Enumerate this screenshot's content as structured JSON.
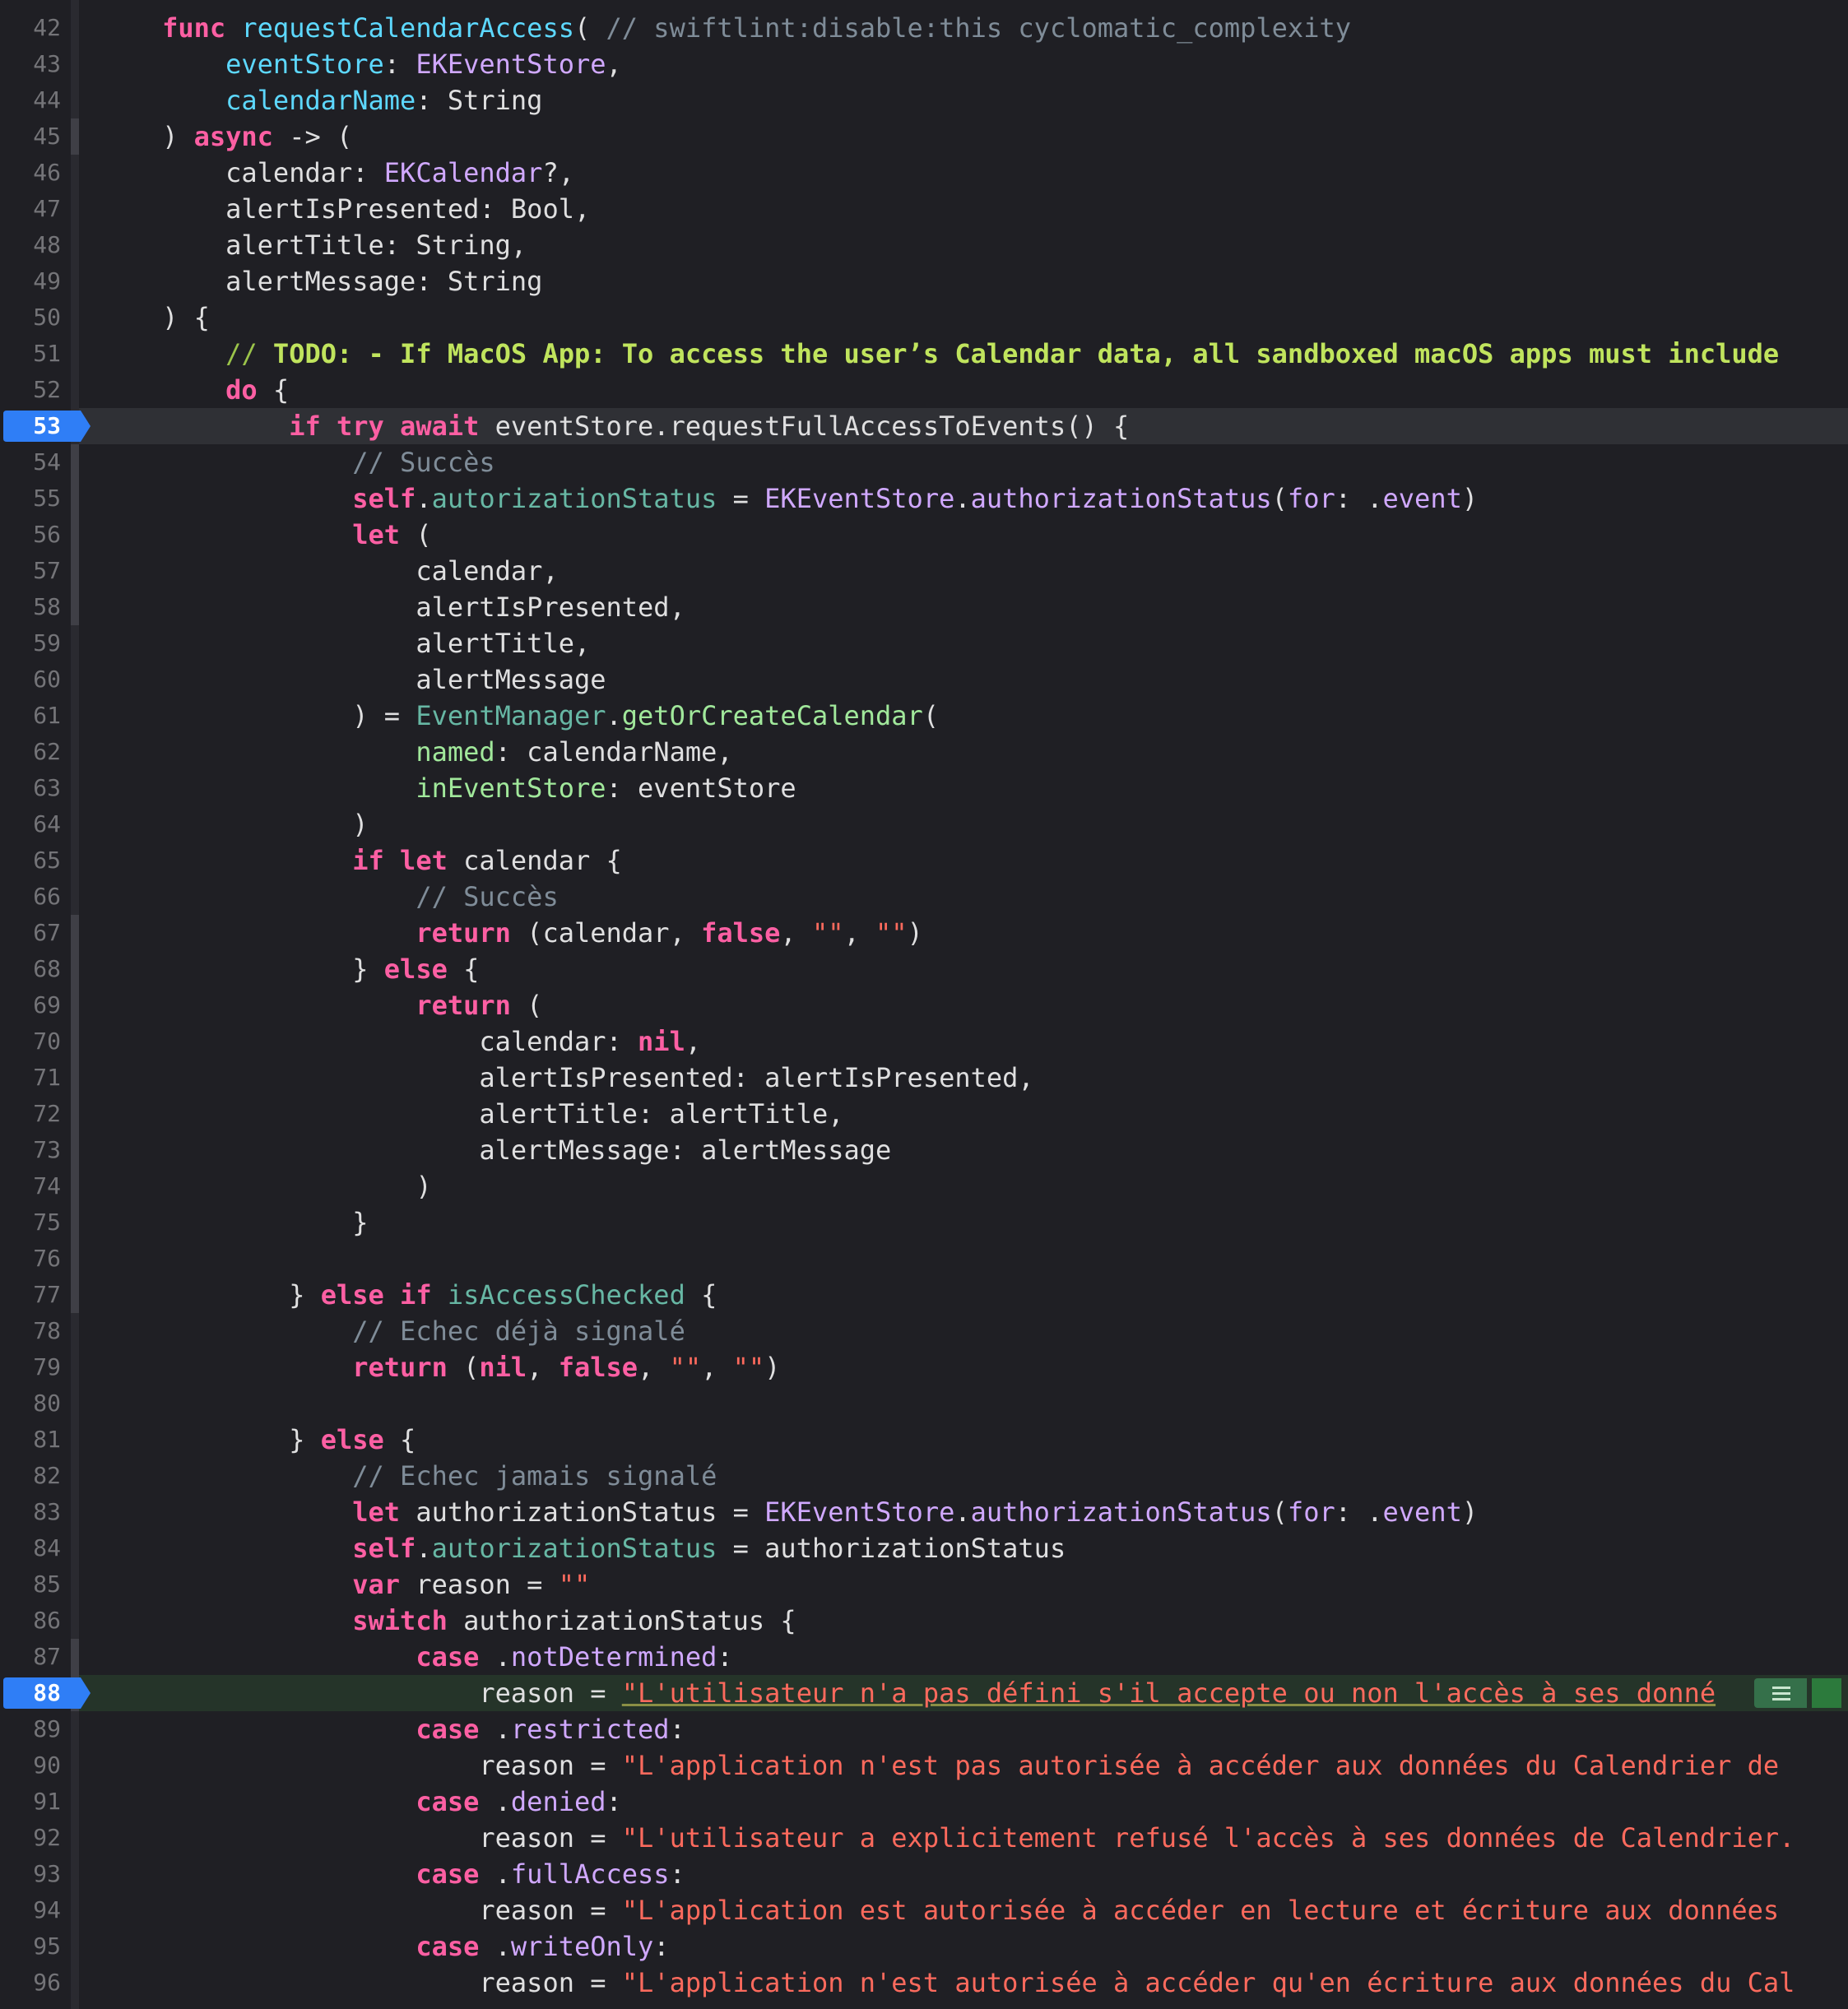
{
  "editor": {
    "language": "swift",
    "theme_colors": {
      "background": "#1f1f24",
      "keyword": "#fc5fa3",
      "declaration": "#5dd8ff",
      "type": "#d0a8ff",
      "project_symbol": "#67b7a4",
      "project_function": "#a1e89b",
      "comment": "#7f8c98",
      "string": "#fc6a5d",
      "breakpoint": "#2f7ef6"
    },
    "breakpoints": [
      53,
      88
    ],
    "current_line": 53,
    "issue_line": 88,
    "lines": [
      {
        "no": "42",
        "tokens": [
          {
            "t": "    ",
            "c": "plain"
          },
          {
            "t": "func",
            "c": "kw"
          },
          {
            "t": " ",
            "c": "plain"
          },
          {
            "t": "requestCalendarAccess",
            "c": "decl"
          },
          {
            "t": "( ",
            "c": "plain"
          },
          {
            "t": "// swiftlint:disable:this cyclomatic_complexity",
            "c": "cmt"
          }
        ]
      },
      {
        "no": "43",
        "tokens": [
          {
            "t": "        ",
            "c": "plain"
          },
          {
            "t": "eventStore",
            "c": "decl"
          },
          {
            "t": ": ",
            "c": "plain"
          },
          {
            "t": "EKEventStore",
            "c": "type"
          },
          {
            "t": ",",
            "c": "plain"
          }
        ]
      },
      {
        "no": "44",
        "tokens": [
          {
            "t": "        ",
            "c": "plain"
          },
          {
            "t": "calendarName",
            "c": "decl"
          },
          {
            "t": ": String",
            "c": "plain"
          }
        ]
      },
      {
        "no": "45",
        "tokens": [
          {
            "t": "    ) ",
            "c": "plain"
          },
          {
            "t": "async",
            "c": "kw"
          },
          {
            "t": " -> (",
            "c": "plain"
          }
        ]
      },
      {
        "no": "46",
        "tokens": [
          {
            "t": "        calendar: ",
            "c": "plain"
          },
          {
            "t": "EKCalendar",
            "c": "type"
          },
          {
            "t": "?,",
            "c": "plain"
          }
        ]
      },
      {
        "no": "47",
        "tokens": [
          {
            "t": "        alertIsPresented: Bool,",
            "c": "plain"
          }
        ]
      },
      {
        "no": "48",
        "tokens": [
          {
            "t": "        alertTitle: String,",
            "c": "plain"
          }
        ]
      },
      {
        "no": "49",
        "tokens": [
          {
            "t": "        alertMessage: String",
            "c": "plain"
          }
        ]
      },
      {
        "no": "50",
        "tokens": [
          {
            "t": "    ) {",
            "c": "plain"
          }
        ]
      },
      {
        "no": "51",
        "tokens": [
          {
            "t": "        ",
            "c": "plain"
          },
          {
            "t": "// ",
            "c": "todocm"
          },
          {
            "t": "TODO: - If MacOS App: To access the user’s Calendar data, all sandboxed macOS apps must include",
            "c": "todo"
          }
        ]
      },
      {
        "no": "52",
        "tokens": [
          {
            "t": "        ",
            "c": "plain"
          },
          {
            "t": "do",
            "c": "kw"
          },
          {
            "t": " {",
            "c": "plain"
          }
        ]
      },
      {
        "no": "53",
        "tokens": [
          {
            "t": "            ",
            "c": "plain"
          },
          {
            "t": "if try await",
            "c": "kw"
          },
          {
            "t": " eventStore.requestFullAccessToEvents() {",
            "c": "plain"
          }
        ]
      },
      {
        "no": "54",
        "tokens": [
          {
            "t": "                ",
            "c": "plain"
          },
          {
            "t": "// Succès",
            "c": "cmt"
          }
        ]
      },
      {
        "no": "55",
        "tokens": [
          {
            "t": "                ",
            "c": "plain"
          },
          {
            "t": "self",
            "c": "kw"
          },
          {
            "t": ".",
            "c": "plain"
          },
          {
            "t": "autorizationStatus",
            "c": "proj"
          },
          {
            "t": " = ",
            "c": "plain"
          },
          {
            "t": "EKEventStore",
            "c": "type"
          },
          {
            "t": ".",
            "c": "plain"
          },
          {
            "t": "authorizationStatus",
            "c": "type"
          },
          {
            "t": "(",
            "c": "plain"
          },
          {
            "t": "for",
            "c": "type"
          },
          {
            "t": ": .",
            "c": "plain"
          },
          {
            "t": "event",
            "c": "type"
          },
          {
            "t": ")",
            "c": "plain"
          }
        ]
      },
      {
        "no": "56",
        "tokens": [
          {
            "t": "                ",
            "c": "plain"
          },
          {
            "t": "let",
            "c": "kw"
          },
          {
            "t": " (",
            "c": "plain"
          }
        ]
      },
      {
        "no": "57",
        "tokens": [
          {
            "t": "                    calendar,",
            "c": "plain"
          }
        ]
      },
      {
        "no": "58",
        "tokens": [
          {
            "t": "                    alertIsPresented,",
            "c": "plain"
          }
        ]
      },
      {
        "no": "59",
        "tokens": [
          {
            "t": "                    alertTitle,",
            "c": "plain"
          }
        ]
      },
      {
        "no": "60",
        "tokens": [
          {
            "t": "                    alertMessage",
            "c": "plain"
          }
        ]
      },
      {
        "no": "61",
        "tokens": [
          {
            "t": "                ) = ",
            "c": "plain"
          },
          {
            "t": "EventManager",
            "c": "proj"
          },
          {
            "t": ".",
            "c": "plain"
          },
          {
            "t": "getOrCreateCalendar",
            "c": "projfn"
          },
          {
            "t": "(",
            "c": "plain"
          }
        ]
      },
      {
        "no": "62",
        "tokens": [
          {
            "t": "                    ",
            "c": "plain"
          },
          {
            "t": "named",
            "c": "projfn"
          },
          {
            "t": ": calendarName,",
            "c": "plain"
          }
        ]
      },
      {
        "no": "63",
        "tokens": [
          {
            "t": "                    ",
            "c": "plain"
          },
          {
            "t": "inEventStore",
            "c": "projfn"
          },
          {
            "t": ": eventStore",
            "c": "plain"
          }
        ]
      },
      {
        "no": "64",
        "tokens": [
          {
            "t": "                )",
            "c": "plain"
          }
        ]
      },
      {
        "no": "65",
        "tokens": [
          {
            "t": "                ",
            "c": "plain"
          },
          {
            "t": "if let",
            "c": "kw"
          },
          {
            "t": " calendar {",
            "c": "plain"
          }
        ]
      },
      {
        "no": "66",
        "tokens": [
          {
            "t": "                    ",
            "c": "plain"
          },
          {
            "t": "// Succès",
            "c": "cmt"
          }
        ]
      },
      {
        "no": "67",
        "tokens": [
          {
            "t": "                    ",
            "c": "plain"
          },
          {
            "t": "return",
            "c": "kw"
          },
          {
            "t": " (calendar, ",
            "c": "plain"
          },
          {
            "t": "false",
            "c": "kw"
          },
          {
            "t": ", ",
            "c": "plain"
          },
          {
            "t": "\"\"",
            "c": "str"
          },
          {
            "t": ", ",
            "c": "plain"
          },
          {
            "t": "\"\"",
            "c": "str"
          },
          {
            "t": ")",
            "c": "plain"
          }
        ]
      },
      {
        "no": "68",
        "tokens": [
          {
            "t": "                } ",
            "c": "plain"
          },
          {
            "t": "else",
            "c": "kw"
          },
          {
            "t": " {",
            "c": "plain"
          }
        ]
      },
      {
        "no": "69",
        "tokens": [
          {
            "t": "                    ",
            "c": "plain"
          },
          {
            "t": "return",
            "c": "kw"
          },
          {
            "t": " (",
            "c": "plain"
          }
        ]
      },
      {
        "no": "70",
        "tokens": [
          {
            "t": "                        calendar: ",
            "c": "plain"
          },
          {
            "t": "nil",
            "c": "kw"
          },
          {
            "t": ",",
            "c": "plain"
          }
        ]
      },
      {
        "no": "71",
        "tokens": [
          {
            "t": "                        alertIsPresented: alertIsPresented,",
            "c": "plain"
          }
        ]
      },
      {
        "no": "72",
        "tokens": [
          {
            "t": "                        alertTitle: alertTitle,",
            "c": "plain"
          }
        ]
      },
      {
        "no": "73",
        "tokens": [
          {
            "t": "                        alertMessage: alertMessage",
            "c": "plain"
          }
        ]
      },
      {
        "no": "74",
        "tokens": [
          {
            "t": "                    )",
            "c": "plain"
          }
        ]
      },
      {
        "no": "75",
        "tokens": [
          {
            "t": "                }",
            "c": "plain"
          }
        ]
      },
      {
        "no": "76",
        "tokens": [
          {
            "t": "",
            "c": "plain"
          }
        ]
      },
      {
        "no": "77",
        "tokens": [
          {
            "t": "            } ",
            "c": "plain"
          },
          {
            "t": "else if",
            "c": "kw"
          },
          {
            "t": " ",
            "c": "plain"
          },
          {
            "t": "isAccessChecked",
            "c": "proj"
          },
          {
            "t": " {",
            "c": "plain"
          }
        ]
      },
      {
        "no": "78",
        "tokens": [
          {
            "t": "                ",
            "c": "plain"
          },
          {
            "t": "// Echec déjà signalé",
            "c": "cmt"
          }
        ]
      },
      {
        "no": "79",
        "tokens": [
          {
            "t": "                ",
            "c": "plain"
          },
          {
            "t": "return",
            "c": "kw"
          },
          {
            "t": " (",
            "c": "plain"
          },
          {
            "t": "nil",
            "c": "kw"
          },
          {
            "t": ", ",
            "c": "plain"
          },
          {
            "t": "false",
            "c": "kw"
          },
          {
            "t": ", ",
            "c": "plain"
          },
          {
            "t": "\"\"",
            "c": "str"
          },
          {
            "t": ", ",
            "c": "plain"
          },
          {
            "t": "\"\"",
            "c": "str"
          },
          {
            "t": ")",
            "c": "plain"
          }
        ]
      },
      {
        "no": "80",
        "tokens": [
          {
            "t": "",
            "c": "plain"
          }
        ]
      },
      {
        "no": "81",
        "tokens": [
          {
            "t": "            } ",
            "c": "plain"
          },
          {
            "t": "else",
            "c": "kw"
          },
          {
            "t": " {",
            "c": "plain"
          }
        ]
      },
      {
        "no": "82",
        "tokens": [
          {
            "t": "                ",
            "c": "plain"
          },
          {
            "t": "// Echec jamais signalé",
            "c": "cmt"
          }
        ]
      },
      {
        "no": "83",
        "tokens": [
          {
            "t": "                ",
            "c": "plain"
          },
          {
            "t": "let",
            "c": "kw"
          },
          {
            "t": " authorizationStatus = ",
            "c": "plain"
          },
          {
            "t": "EKEventStore",
            "c": "type"
          },
          {
            "t": ".",
            "c": "plain"
          },
          {
            "t": "authorizationStatus",
            "c": "type"
          },
          {
            "t": "(",
            "c": "plain"
          },
          {
            "t": "for",
            "c": "type"
          },
          {
            "t": ": .",
            "c": "plain"
          },
          {
            "t": "event",
            "c": "type"
          },
          {
            "t": ")",
            "c": "plain"
          }
        ]
      },
      {
        "no": "84",
        "tokens": [
          {
            "t": "                ",
            "c": "plain"
          },
          {
            "t": "self",
            "c": "kw"
          },
          {
            "t": ".",
            "c": "plain"
          },
          {
            "t": "autorizationStatus",
            "c": "proj"
          },
          {
            "t": " = authorizationStatus",
            "c": "plain"
          }
        ]
      },
      {
        "no": "85",
        "tokens": [
          {
            "t": "                ",
            "c": "plain"
          },
          {
            "t": "var",
            "c": "kw"
          },
          {
            "t": " reason = ",
            "c": "plain"
          },
          {
            "t": "\"\"",
            "c": "str"
          }
        ]
      },
      {
        "no": "86",
        "tokens": [
          {
            "t": "                ",
            "c": "plain"
          },
          {
            "t": "switch",
            "c": "kw"
          },
          {
            "t": " authorizationStatus {",
            "c": "plain"
          }
        ]
      },
      {
        "no": "87",
        "tokens": [
          {
            "t": "                    ",
            "c": "plain"
          },
          {
            "t": "case",
            "c": "kw"
          },
          {
            "t": " .",
            "c": "plain"
          },
          {
            "t": "notDetermined",
            "c": "type"
          },
          {
            "t": ":",
            "c": "plain"
          }
        ]
      },
      {
        "no": "88",
        "tokens": [
          {
            "t": "                        reason = ",
            "c": "plain"
          },
          {
            "t": "\"L'utilisateur n'a pas défini s'il accepte ou non l'accès à ses donné",
            "c": "link"
          }
        ]
      },
      {
        "no": "89",
        "tokens": [
          {
            "t": "                    ",
            "c": "plain"
          },
          {
            "t": "case",
            "c": "kw"
          },
          {
            "t": " .",
            "c": "plain"
          },
          {
            "t": "restricted",
            "c": "type"
          },
          {
            "t": ":",
            "c": "plain"
          }
        ]
      },
      {
        "no": "90",
        "tokens": [
          {
            "t": "                        reason = ",
            "c": "plain"
          },
          {
            "t": "\"L'application n'est pas autorisée à accéder aux données du Calendrier de",
            "c": "str"
          }
        ]
      },
      {
        "no": "91",
        "tokens": [
          {
            "t": "                    ",
            "c": "plain"
          },
          {
            "t": "case",
            "c": "kw"
          },
          {
            "t": " .",
            "c": "plain"
          },
          {
            "t": "denied",
            "c": "type"
          },
          {
            "t": ":",
            "c": "plain"
          }
        ]
      },
      {
        "no": "92",
        "tokens": [
          {
            "t": "                        reason = ",
            "c": "plain"
          },
          {
            "t": "\"L'utilisateur a explicitement refusé l'accès à ses données de Calendrier.",
            "c": "str"
          }
        ]
      },
      {
        "no": "93",
        "tokens": [
          {
            "t": "                    ",
            "c": "plain"
          },
          {
            "t": "case",
            "c": "kw"
          },
          {
            "t": " .",
            "c": "plain"
          },
          {
            "t": "fullAccess",
            "c": "type"
          },
          {
            "t": ":",
            "c": "plain"
          }
        ]
      },
      {
        "no": "94",
        "tokens": [
          {
            "t": "                        reason = ",
            "c": "plain"
          },
          {
            "t": "\"L'application est autorisée à accéder en lecture et écriture aux données",
            "c": "str"
          }
        ]
      },
      {
        "no": "95",
        "tokens": [
          {
            "t": "                    ",
            "c": "plain"
          },
          {
            "t": "case",
            "c": "kw"
          },
          {
            "t": " .",
            "c": "plain"
          },
          {
            "t": "writeOnly",
            "c": "type"
          },
          {
            "t": ":",
            "c": "plain"
          }
        ]
      },
      {
        "no": "96",
        "tokens": [
          {
            "t": "                        reason = ",
            "c": "plain"
          },
          {
            "t": "\"L'application n'est autorisée à accéder qu'en écriture aux données du Cal",
            "c": "str"
          }
        ]
      }
    ]
  }
}
